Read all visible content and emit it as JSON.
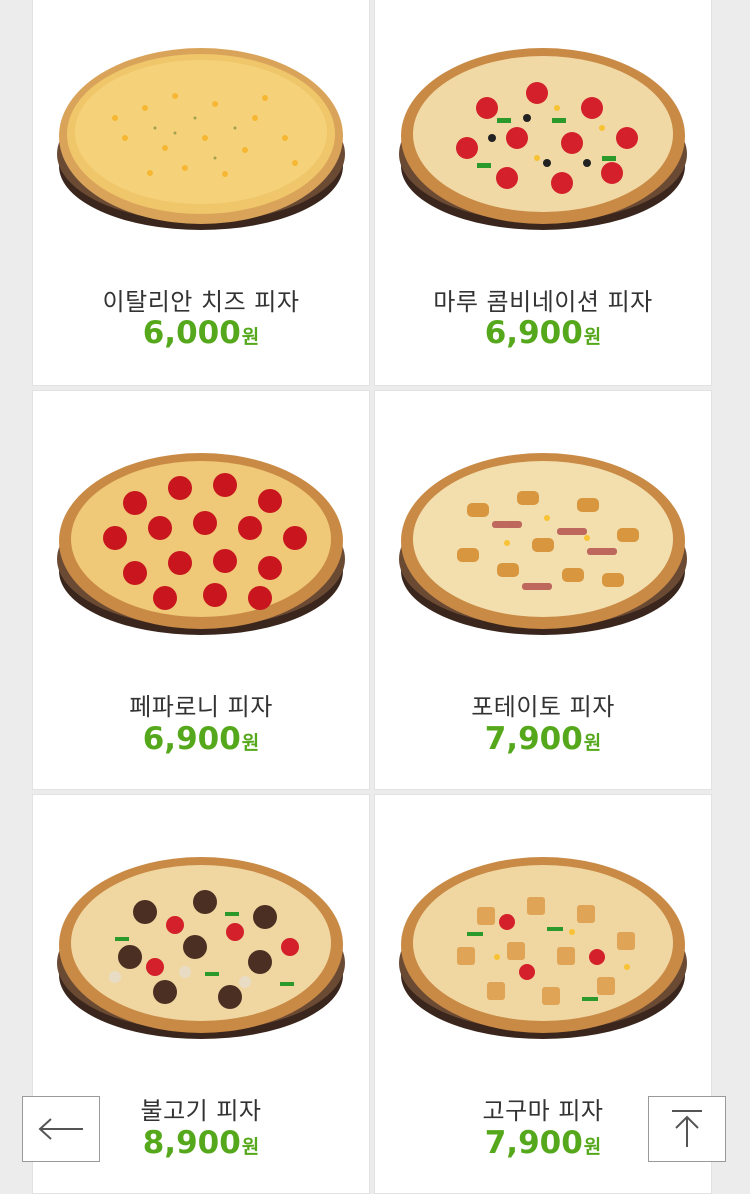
{
  "menu": [
    {
      "name": "이탈리안 치즈 피자",
      "price": "6,000",
      "unit": "원",
      "style": "cheese"
    },
    {
      "name": "마루 콤비네이션 피자",
      "price": "6,900",
      "unit": "원",
      "style": "combination"
    },
    {
      "name": "페파로니 피자",
      "price": "6,900",
      "unit": "원",
      "style": "pepperoni"
    },
    {
      "name": "포테이토 피자",
      "price": "7,900",
      "unit": "원",
      "style": "potato"
    },
    {
      "name": "불고기 피자",
      "price": "8,900",
      "unit": "원",
      "style": "bulgogi"
    },
    {
      "name": "고구마 피자",
      "price": "7,900",
      "unit": "원",
      "style": "sweet-potato"
    }
  ],
  "controls": {
    "back_icon": "arrow-left-icon",
    "top_icon": "arrow-up-to-top-icon"
  },
  "colors": {
    "price": "#55a81b",
    "name": "#333333",
    "background": "#ececec",
    "card": "#ffffff"
  }
}
